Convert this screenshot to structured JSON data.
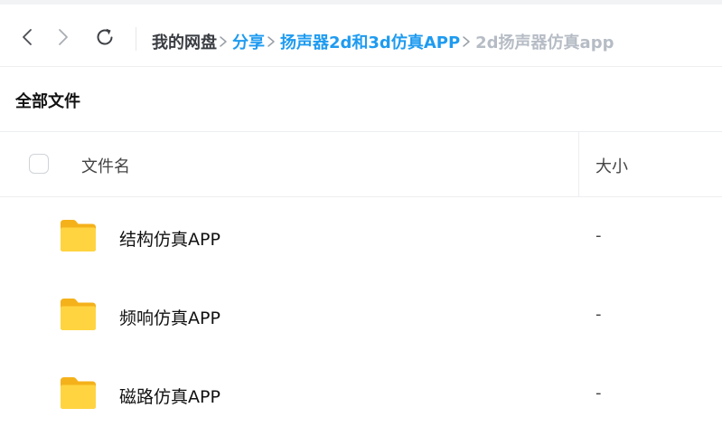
{
  "navigation": {
    "back_icon": "chevron-left-icon",
    "forward_icon": "chevron-right-icon",
    "refresh_icon": "refresh-icon"
  },
  "breadcrumb": {
    "root": "我的网盘",
    "items": [
      "分享",
      "扬声器2d和3d仿真APP"
    ],
    "current": "2d扬声器仿真app"
  },
  "section": {
    "title": "全部文件"
  },
  "table": {
    "headers": {
      "name": "文件名",
      "size": "大小"
    },
    "rows": [
      {
        "name": "结构仿真APP",
        "size": "-",
        "icon": "folder-icon"
      },
      {
        "name": "频响仿真APP",
        "size": "-",
        "icon": "folder-icon"
      },
      {
        "name": "磁路仿真APP",
        "size": "-",
        "icon": "folder-icon"
      }
    ]
  },
  "colors": {
    "link": "#1e9bf0",
    "current_crumb": "#b6bcc5",
    "folder_front": "#ffd440",
    "folder_back": "#f4b11a"
  }
}
